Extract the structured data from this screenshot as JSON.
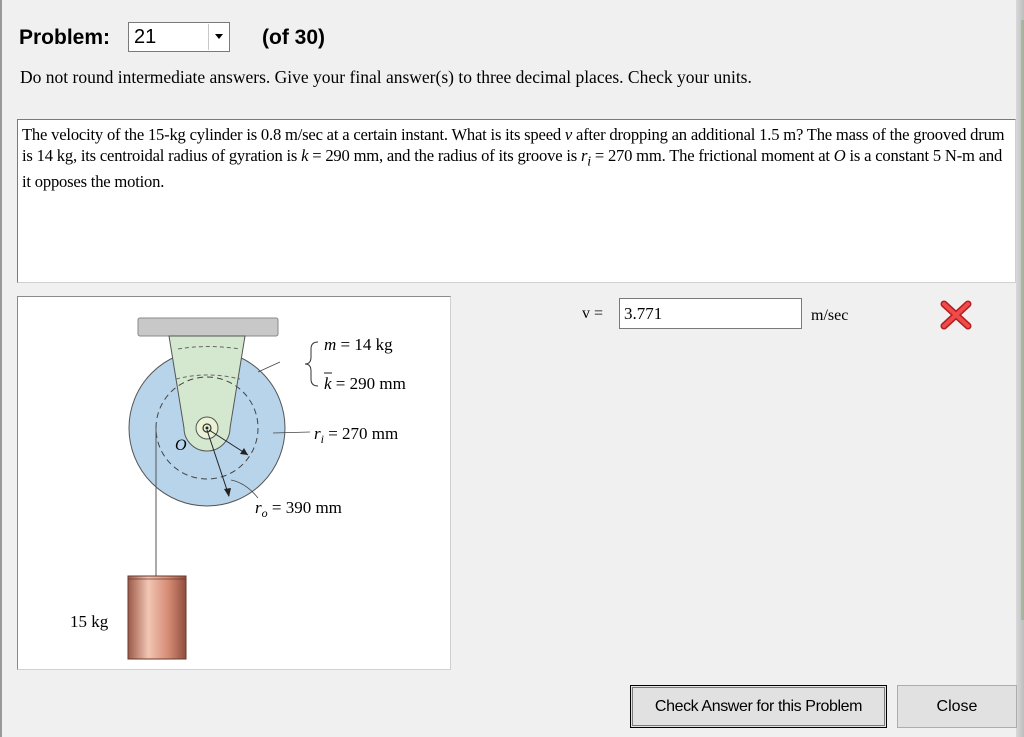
{
  "header": {
    "problem_label": "Problem:",
    "problem_number": "21",
    "of_total": "(of 30)"
  },
  "instructions": "Do not round intermediate answers.  Give your final answer(s) to three decimal places.  Check your units.",
  "statement": {
    "p1": "The velocity of the 15-kg cylinder is 0.8 m/sec at a certain instant. What is its speed ",
    "v": "v",
    "p2": " after dropping an additional 1.5 m? The mass of the grooved drum is 14 kg, its centroidal radius of gyration is ",
    "k": "k",
    "p3": " = 290 mm, and the radius of its groove is ",
    "ri": "r",
    "ri_sub": "i",
    "p4": " = 270 mm. The frictional moment at ",
    "o": "O",
    "p5": " is a constant 5 N-m and it opposes the motion."
  },
  "figure": {
    "mass_label": "m = 14 kg",
    "k_label": "k = 290 mm",
    "ri_label": "r",
    "ri_sub": "i",
    "ri_value": " = 270 mm",
    "ro_label": "r",
    "ro_sub": "o",
    "ro_value": " = 390 mm",
    "o_label": "O",
    "cylinder_label": "15 kg"
  },
  "answer": {
    "var_label": "v =",
    "value": "3.771",
    "unit": "m/sec",
    "status": "incorrect"
  },
  "buttons": {
    "check": "Check Answer for this Problem",
    "close": "Close"
  },
  "colors": {
    "drum": "#b8d4ea",
    "bracket": "#d4e8d0",
    "ceiling": "#c8c8c8",
    "cylinder": "#d58b73",
    "wrong_mark": "#e23a3a"
  }
}
